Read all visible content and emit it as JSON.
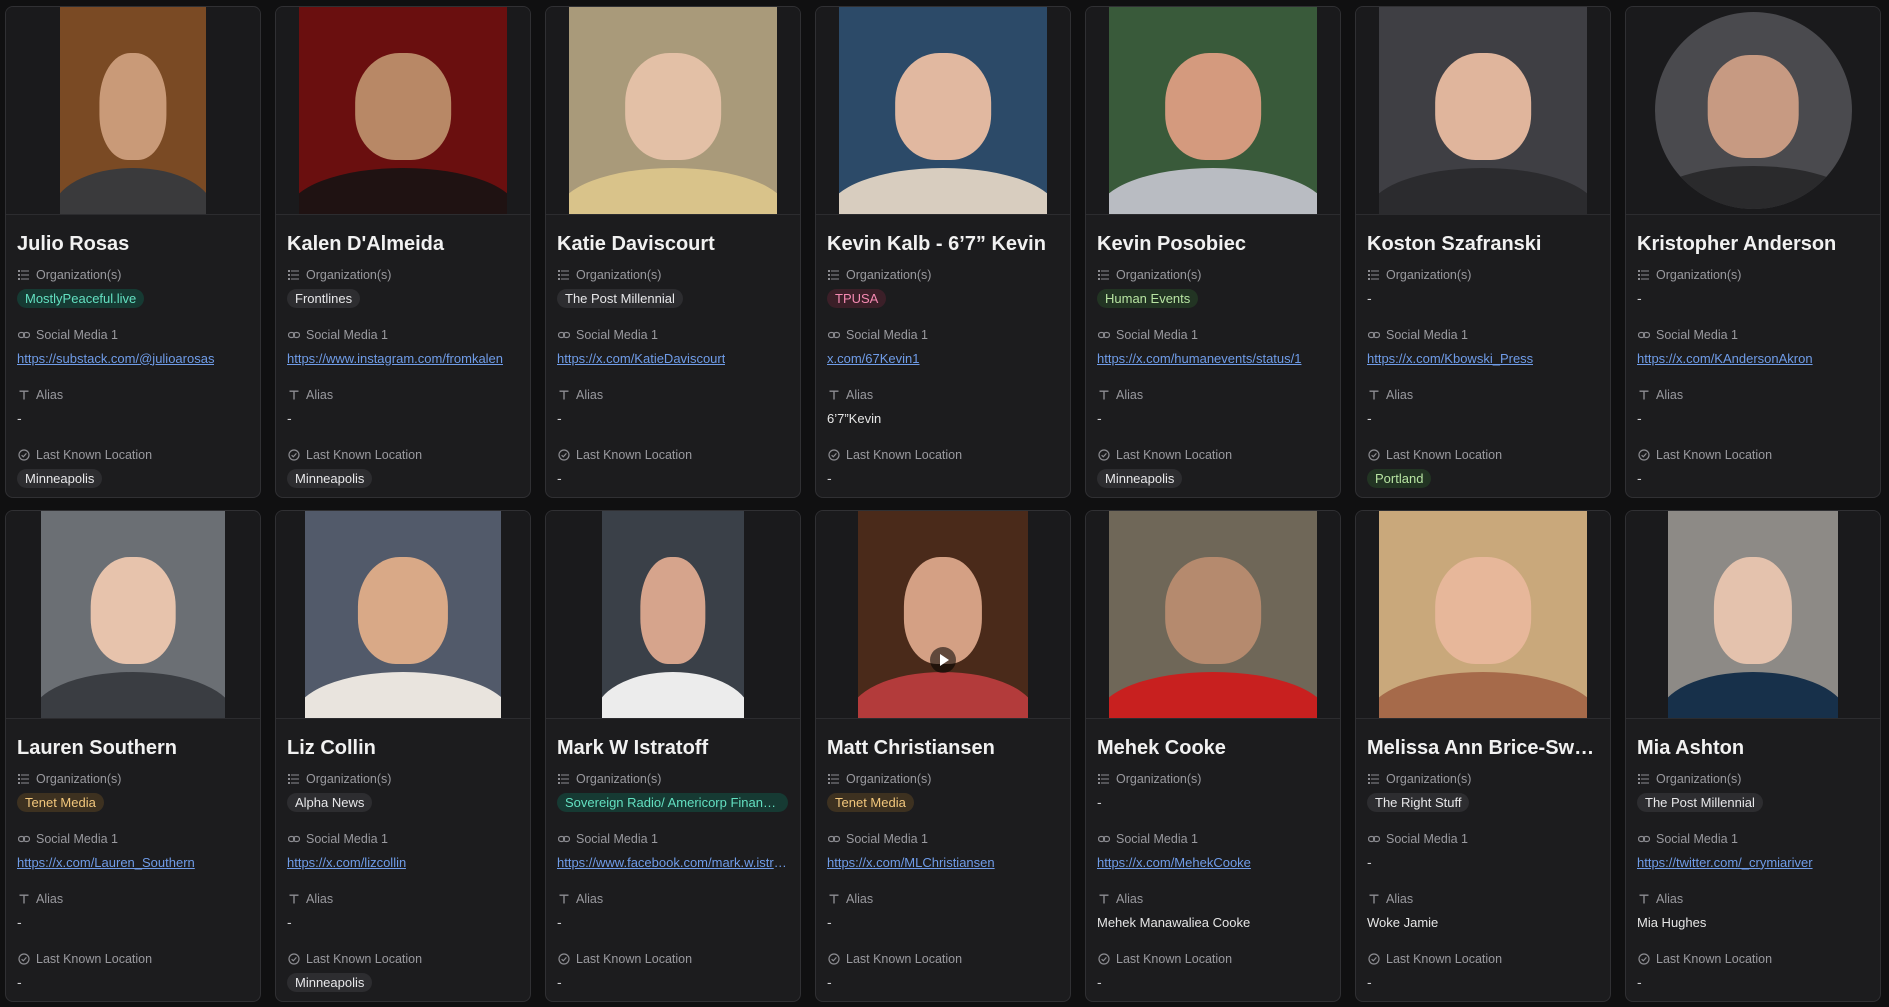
{
  "labels": {
    "organization": "Organization(s)",
    "social": "Social Media 1",
    "alias": "Alias",
    "location": "Last Known Location"
  },
  "colors": {
    "background": "#101011",
    "card": "#1c1c1e",
    "link": "#6f9ce8",
    "tag_teal_bg": "#163a33",
    "tag_teal_fg": "#63e0c1",
    "tag_gray_bg": "#2d2d30",
    "tag_gray_fg": "#e8e8ea",
    "tag_pink_bg": "#3b1f28",
    "tag_pink_fg": "#f58ab2",
    "tag_green_bg": "#223423",
    "tag_green_fg": "#b7e4a2",
    "tag_amber_bg": "#3d3120",
    "tag_amber_fg": "#f2c77c"
  },
  "cards": [
    {
      "name": "Julio Rosas",
      "org": "MostlyPeaceful.live",
      "org_color": "teal",
      "social": "https://substack.com/@julioarosas",
      "alias": "-",
      "location": "Minneapolis",
      "photo_bg": "#7a4a24",
      "photo_skin": "#c99a78",
      "photo_shirt": "#3a3a3c",
      "photo_w": 146
    },
    {
      "name": "Kalen D'Almeida",
      "org": "Frontlines",
      "org_color": "gray",
      "social": "https://www.instagram.com/fromkalen",
      "alias": "-",
      "location": "Minneapolis",
      "photo_bg": "#6a0f0f",
      "photo_skin": "#b88866",
      "photo_shirt": "#1f1212",
      "photo_w": 208
    },
    {
      "name": "Katie Daviscourt",
      "org": "The Post Millennial",
      "org_color": "gray",
      "social": "https://x.com/KatieDaviscourt",
      "alias": "-",
      "location": "-",
      "photo_bg": "#a99a7a",
      "photo_skin": "#e3c0a6",
      "photo_shirt": "#d9c38a",
      "photo_w": 208
    },
    {
      "name": "Kevin Kalb - 6’7” Kevin",
      "org": "TPUSA",
      "org_color": "pink",
      "social": "x.com/67Kevin1",
      "alias": "6’7”Kevin",
      "location": "-",
      "photo_bg": "#2c4a68",
      "photo_skin": "#e1b8a0",
      "photo_shirt": "#d8cdbf",
      "photo_w": 208
    },
    {
      "name": "Kevin Posobiec",
      "org": "Human Events",
      "org_color": "green",
      "social": "https://x.com/humanevents/status/1",
      "alias": "-",
      "location": "Minneapolis",
      "photo_bg": "#395a3a",
      "photo_skin": "#d49a7e",
      "photo_shirt": "#b9bcc2",
      "photo_w": 208
    },
    {
      "name": "Koston Szafranski",
      "org": "-",
      "org_color": "none",
      "social": "https://x.com/Kbowski_Press",
      "alias": "-",
      "location": "Portland",
      "location_color": "green",
      "photo_bg": "#3f3f44",
      "photo_skin": "#e0b59c",
      "photo_shirt": "#2b2b2e",
      "photo_w": 208
    },
    {
      "name": "Kristopher Anderson",
      "org": "-",
      "org_color": "none",
      "social": "https://x.com/KAndersonAkron",
      "alias": "-",
      "location": "-",
      "photo_bg": "#4a4a4e",
      "photo_skin": "#c79a82",
      "photo_shirt": "#2a2a2c",
      "photo_w": 197,
      "photo_round": true
    },
    {
      "name": "Lauren Southern",
      "org": "Tenet Media",
      "org_color": "amber",
      "social": "https://x.com/Lauren_Southern",
      "alias": "-",
      "location": "-",
      "photo_bg": "#6b6f74",
      "photo_skin": "#e7c3ac",
      "photo_shirt": "#3a3d42",
      "photo_w": 184
    },
    {
      "name": "Liz Collin",
      "org": "Alpha News",
      "org_color": "gray",
      "social": "https://x.com/lizcollin",
      "alias": "-",
      "location": "Minneapolis",
      "photo_bg": "#525a6a",
      "photo_skin": "#d9a987",
      "photo_shirt": "#e9e4de",
      "photo_w": 196
    },
    {
      "name": "Mark W Istratoff",
      "org": "Sovereign Radio/ Americorp Financial",
      "org_color": "teal",
      "social": "https://www.facebook.com/mark.w.istratoff",
      "alias": "-",
      "location": "-",
      "photo_bg": "#3a4048",
      "photo_skin": "#d6a48c",
      "photo_shirt": "#ececec",
      "photo_w": 142
    },
    {
      "name": "Matt Christiansen",
      "org": "Tenet Media",
      "org_color": "amber",
      "social": "https://x.com/MLChristiansen",
      "alias": "-",
      "location": "-",
      "photo_bg": "#4a2a1a",
      "photo_skin": "#d4a084",
      "photo_shirt": "#b33b3b",
      "photo_w": 170,
      "play": true
    },
    {
      "name": "Mehek Cooke",
      "org": "-",
      "org_color": "none",
      "social": "https://x.com/MehekCooke",
      "alias": "Mehek Manawaliea Cooke",
      "location": "-",
      "photo_bg": "#6f6758",
      "photo_skin": "#b58a6e",
      "photo_shirt": "#c8201f",
      "photo_w": 208
    },
    {
      "name": "Melissa Ann Brice-Swenson",
      "org": "The Right Stuff",
      "org_color": "gray",
      "social": "-",
      "alias": "Woke Jamie",
      "location": "-",
      "photo_bg": "#c9a87b",
      "photo_skin": "#e7b79a",
      "photo_shirt": "#a66a4a",
      "photo_w": 208
    },
    {
      "name": "Mia Ashton",
      "org": "The Post Millennial",
      "org_color": "gray",
      "social": "https://twitter.com/_crymiariver",
      "alias": "Mia Hughes",
      "location": "-",
      "photo_bg": "#8d8a86",
      "photo_skin": "#e4c2ad",
      "photo_shirt": "#17304a",
      "photo_w": 170
    }
  ]
}
